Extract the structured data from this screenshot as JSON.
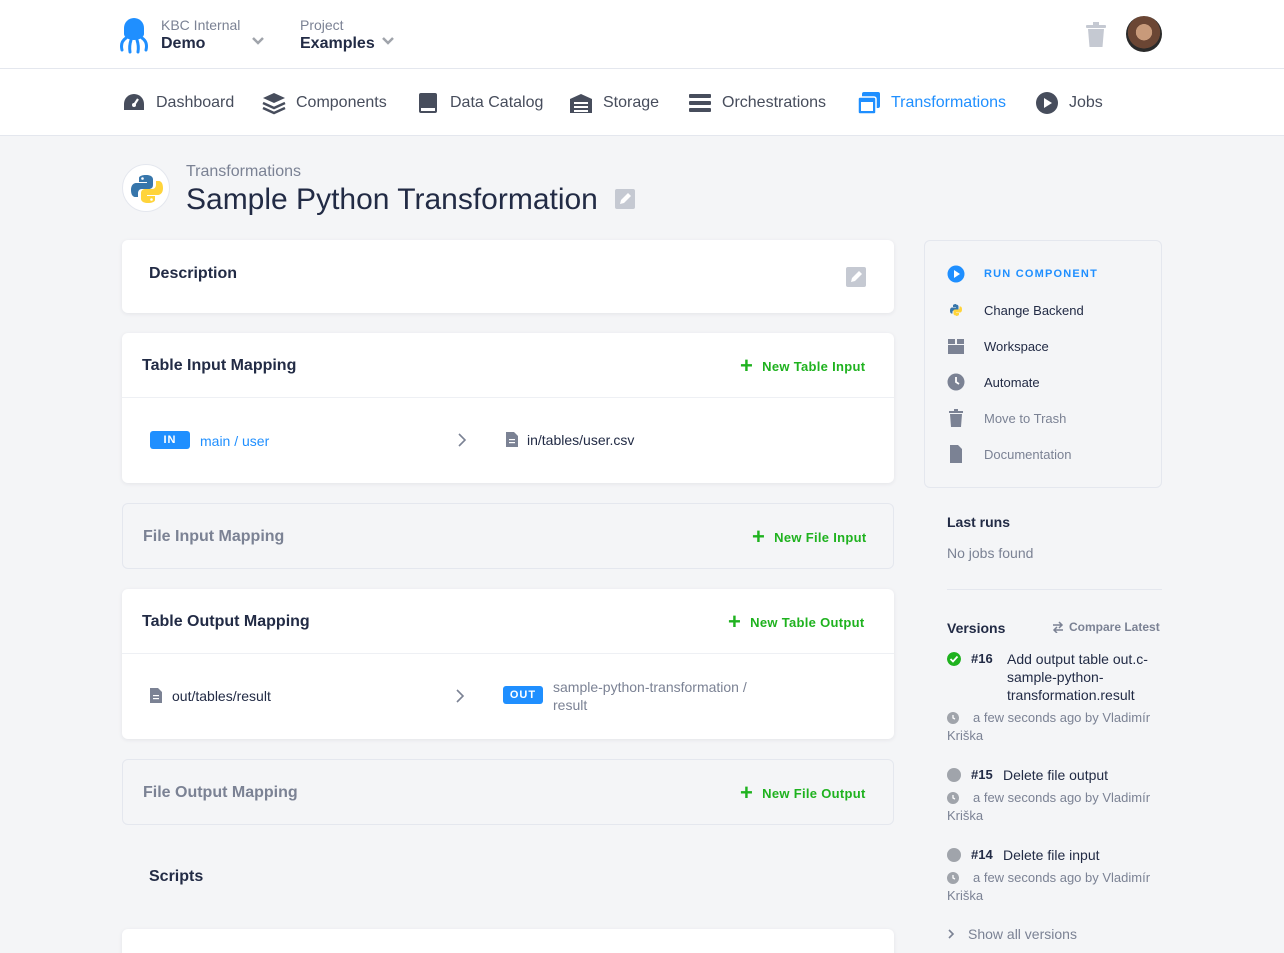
{
  "topbar": {
    "org_label": "KBC Internal",
    "org_name": "Demo",
    "project_label": "Project",
    "project_name": "Examples"
  },
  "nav": {
    "items": [
      {
        "label": "Dashboard",
        "icon": "dashboard-icon"
      },
      {
        "label": "Components",
        "icon": "layers-icon"
      },
      {
        "label": "Data Catalog",
        "icon": "book-icon"
      },
      {
        "label": "Storage",
        "icon": "warehouse-icon"
      },
      {
        "label": "Orchestrations",
        "icon": "bars-icon"
      },
      {
        "label": "Transformations",
        "icon": "window-icon",
        "active": true
      },
      {
        "label": "Jobs",
        "icon": "play-circle-icon"
      }
    ]
  },
  "header": {
    "breadcrumb": "Transformations",
    "title": "Sample Python Transformation"
  },
  "description": {
    "title": "Description"
  },
  "table_input": {
    "title": "Table Input Mapping",
    "add_label": "New Table Input",
    "rows": [
      {
        "badge": "IN",
        "source": "main / user",
        "destination": "in/tables/user.csv"
      }
    ]
  },
  "file_input": {
    "title": "File Input Mapping",
    "add_label": "New File Input"
  },
  "table_output": {
    "title": "Table Output Mapping",
    "add_label": "New Table Output",
    "rows": [
      {
        "source": "out/tables/result",
        "badge": "OUT",
        "destination_line1": "sample-python-transformation /",
        "destination_line2": "result"
      }
    ]
  },
  "file_output": {
    "title": "File Output Mapping",
    "add_label": "New File Output"
  },
  "scripts": {
    "title": "Scripts"
  },
  "sidebar": {
    "actions": [
      {
        "label": "RUN COMPONENT",
        "icon": "play-circle-icon"
      },
      {
        "label": "Change Backend",
        "icon": "python-icon"
      },
      {
        "label": "Workspace",
        "icon": "box-icon"
      },
      {
        "label": "Automate",
        "icon": "clock-icon"
      },
      {
        "label": "Move to Trash",
        "icon": "trash-icon"
      },
      {
        "label": "Documentation",
        "icon": "file-icon"
      }
    ],
    "last_runs": {
      "title": "Last runs",
      "empty": "No jobs found"
    },
    "versions": {
      "title": "Versions",
      "compare_label": "Compare Latest",
      "items": [
        {
          "number": "#16",
          "desc_lines": [
            "Add output table out.c-",
            "sample-python-",
            "transformation.result"
          ],
          "meta1": "a few seconds ago by Vladimír",
          "meta2": "Kriška",
          "status_color": "#1fb21f"
        },
        {
          "number": "#15",
          "desc_lines": [
            "Delete file output"
          ],
          "meta1": "a few seconds ago by Vladimír",
          "meta2": "Kriška",
          "status_color": "#a0a4ab"
        },
        {
          "number": "#14",
          "desc_lines": [
            "Delete file input"
          ],
          "meta1": "a few seconds ago by Vladimír",
          "meta2": "Kriška",
          "status_color": "#a0a4ab"
        }
      ],
      "show_all": "Show all versions"
    }
  },
  "colors": {
    "accent": "#1f8fff",
    "success": "#1fb21f",
    "muted": "#7b8294"
  }
}
